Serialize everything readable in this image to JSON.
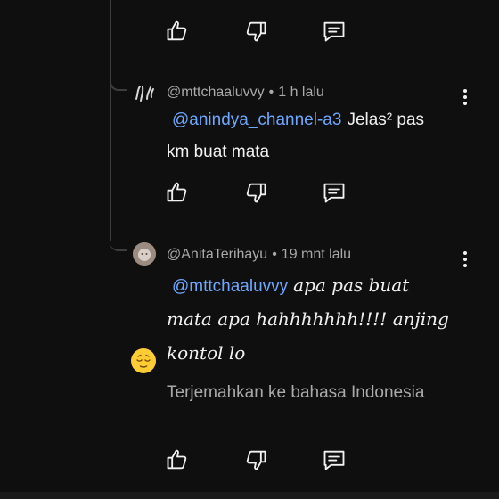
{
  "comments": [
    {
      "author": "@mttchaaluvvy",
      "separator": "•",
      "time": "1 h lalu",
      "mention": "@anindya_channel-a3",
      "text_part1": "Jelas² pas",
      "text_part2": "km buat mata"
    },
    {
      "author": "@AnitaTerihayu",
      "separator": "•",
      "time": "19 mnt lalu",
      "mention": "@mttchaaluvvy",
      "text_line1": "apa pas buat",
      "text_line2": "mata apa hahhhhhhh!!!! anjing",
      "text_line3": "kontol lo",
      "translate_label": "Terjemahkan ke bahasa Indonesia"
    }
  ],
  "icons": {
    "like": "thumbs-up-icon",
    "dislike": "thumbs-down-icon",
    "reply": "reply-comment-icon",
    "more": "more-vertical-icon",
    "emoji": "relieved-face-emoji"
  },
  "colors": {
    "background": "#0f0f0f",
    "text": "#f1f1f1",
    "secondary_text": "#aaaaaa",
    "mention": "#6ea8fe",
    "thread_line": "#3d3d3d"
  }
}
